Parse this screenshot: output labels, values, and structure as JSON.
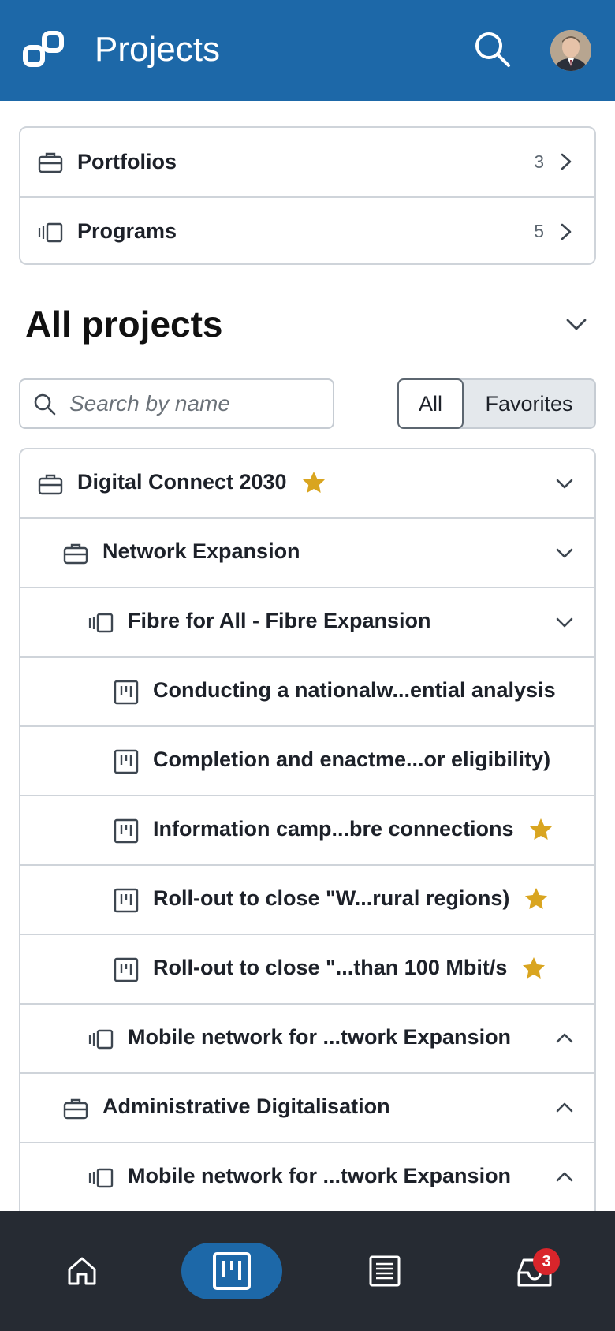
{
  "header": {
    "title": "Projects",
    "logo_icon": "link-logo-icon",
    "search_icon": "search-icon",
    "avatar_icon": "user-avatar"
  },
  "nav": [
    {
      "label": "Portfolios",
      "count": "3",
      "icon": "briefcase-icon"
    },
    {
      "label": "Programs",
      "count": "5",
      "icon": "program-stack-icon"
    }
  ],
  "section": {
    "title": "All projects"
  },
  "search": {
    "placeholder": "Search by name",
    "value": ""
  },
  "filter": {
    "all": "All",
    "favorites": "Favorites",
    "selected": "All"
  },
  "tree": [
    {
      "label": "Digital Connect 2030",
      "type": "portfolio",
      "level": 0,
      "favorite": true,
      "toggle": "expanded"
    },
    {
      "label": "Network Expansion",
      "type": "portfolio",
      "level": 1,
      "favorite": false,
      "toggle": "expanded"
    },
    {
      "label": "Fibre for All - Fibre Expansion",
      "type": "program",
      "level": 2,
      "favorite": false,
      "toggle": "expanded"
    },
    {
      "label": "Conducting a nationalw...ential analysis",
      "type": "project",
      "level": 3,
      "favorite": false,
      "toggle": "none"
    },
    {
      "label": "Completion and enactme...or eligibility)",
      "type": "project",
      "level": 3,
      "favorite": false,
      "toggle": "none"
    },
    {
      "label": "Information camp...bre connections",
      "type": "project",
      "level": 3,
      "favorite": true,
      "toggle": "none"
    },
    {
      "label": "Roll-out to close \"W...rural regions)",
      "type": "project",
      "level": 3,
      "favorite": true,
      "toggle": "none"
    },
    {
      "label": "Roll-out to close \"...than 100 Mbit/s",
      "type": "project",
      "level": 3,
      "favorite": true,
      "toggle": "none"
    },
    {
      "label": "Mobile network for ...twork Expansion",
      "type": "program",
      "level": 2,
      "favorite": false,
      "toggle": "collapsed"
    },
    {
      "label": "Administrative Digitalisation",
      "type": "portfolio",
      "level": 1,
      "favorite": false,
      "toggle": "collapsed"
    },
    {
      "label": "Mobile network for ...twork Expansion",
      "type": "program",
      "level": 2,
      "favorite": false,
      "toggle": "collapsed"
    }
  ],
  "bottom_nav": {
    "items": [
      {
        "name": "home",
        "icon": "home-icon"
      },
      {
        "name": "projects",
        "icon": "board-icon",
        "active": true
      },
      {
        "name": "list",
        "icon": "list-icon"
      },
      {
        "name": "inbox",
        "icon": "inbox-icon"
      }
    ],
    "inbox_badge": "3"
  },
  "colors": {
    "header": "#1d68a8",
    "bottom_bar": "#262b33",
    "star": "#d9a520",
    "badge": "#d9252b"
  }
}
